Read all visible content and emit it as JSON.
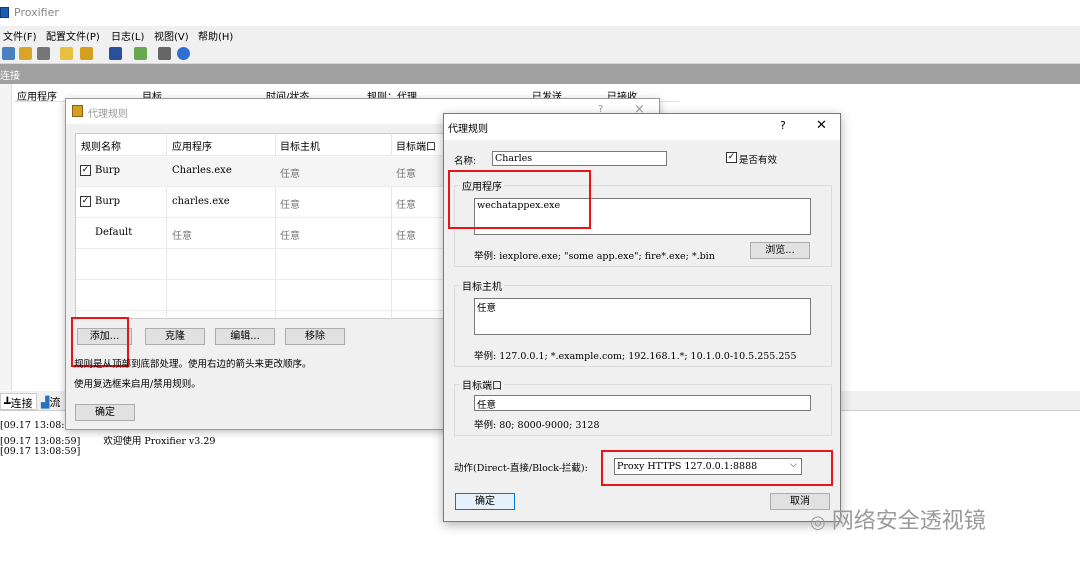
{
  "app": {
    "title": "Proxifier",
    "menu": [
      "文件(F)",
      "配置文件(P)",
      "日志(L)",
      "视图(V)",
      "帮助(H)"
    ],
    "connections_header": "连接",
    "connection_columns": [
      "应用程序",
      "目标",
      "时间/状态",
      "规则：代理",
      "已发送",
      "已接收"
    ],
    "bottom_tabs": [
      "连接",
      "流"
    ],
    "log": [
      {
        "time": "[09.17 13:08:",
        "msg": ""
      },
      {
        "time": "[09.17 13:08:59]",
        "msg": "欢迎使用 Proxifier v3.29"
      },
      {
        "time": "[09.17 13:08:59]",
        "msg": ""
      }
    ]
  },
  "rules_dialog": {
    "title": "代理规则",
    "help": "?",
    "close": "×",
    "columns": [
      "规则名称",
      "应用程序",
      "目标主机",
      "目标端口"
    ],
    "rows": [
      {
        "checked": true,
        "name": "Burp",
        "app": "Charles.exe",
        "host": "任意",
        "port": "任意"
      },
      {
        "checked": true,
        "name": "Burp",
        "app": "charles.exe",
        "host": "任意",
        "port": "任意"
      },
      {
        "checked": false,
        "name": "Default",
        "app": "任意",
        "host": "任意",
        "port": "任意"
      }
    ],
    "buttons": {
      "add": "添加...",
      "clone": "克隆",
      "edit": "编辑...",
      "remove": "移除"
    },
    "hint1": "规则是从顶部到底部处理。使用右边的箭头来更改顺序。",
    "hint2": "使用复选框来启用/禁用规则。",
    "ok": "确定"
  },
  "edit_dialog": {
    "title": "代理规则",
    "help": "?",
    "close": "✕",
    "name_label": "名称:",
    "name_value": "Charles",
    "enabled_label": "是否有效",
    "enabled": true,
    "apps_group": "应用程序",
    "apps_value": "wechatappex.exe",
    "apps_example": "举例: iexplore.exe; \"some app.exe\"; fire*.exe; *.bin",
    "browse": "浏览...",
    "hosts_group": "目标主机",
    "hosts_value": "任意",
    "hosts_example": "举例: 127.0.0.1; *.example.com; 192.168.1.*; 10.1.0.0-10.5.255.255",
    "ports_group": "目标端口",
    "ports_value": "任意",
    "ports_example": "举例: 80; 8000-9000; 3128",
    "action_label": "动作(Direct-直接/Block-拦截):",
    "action_value": "Proxy HTTPS 127.0.0.1:8888",
    "ok": "确定",
    "cancel": "取消"
  },
  "watermark": "网络安全透视镜",
  "colors": {
    "highlight": "#e8141a",
    "accent": "#0078d7"
  }
}
